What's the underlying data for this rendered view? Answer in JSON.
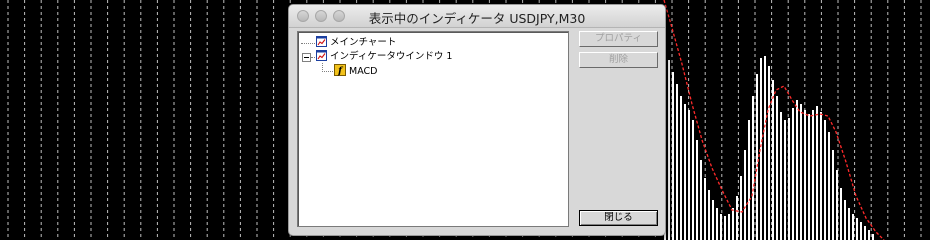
{
  "dialog": {
    "title": "表示中のインディケータ USDJPY,M30",
    "tree": {
      "main_chart": "メインチャート",
      "indicator_window": "インディケータウインドウ 1",
      "indicator_item": "MACD"
    },
    "buttons": {
      "properties": "プロパティ",
      "delete": "削除",
      "close": "閉じる"
    }
  },
  "colors": {
    "chart_background": "#000000",
    "histogram": "#ffffff",
    "signal_line": "#ff2a2a",
    "grid": "#bfbfbf"
  },
  "icons": {
    "main_chart": "chart-icon",
    "indicator_window": "chart-icon",
    "indicator_item": "function-icon"
  }
}
